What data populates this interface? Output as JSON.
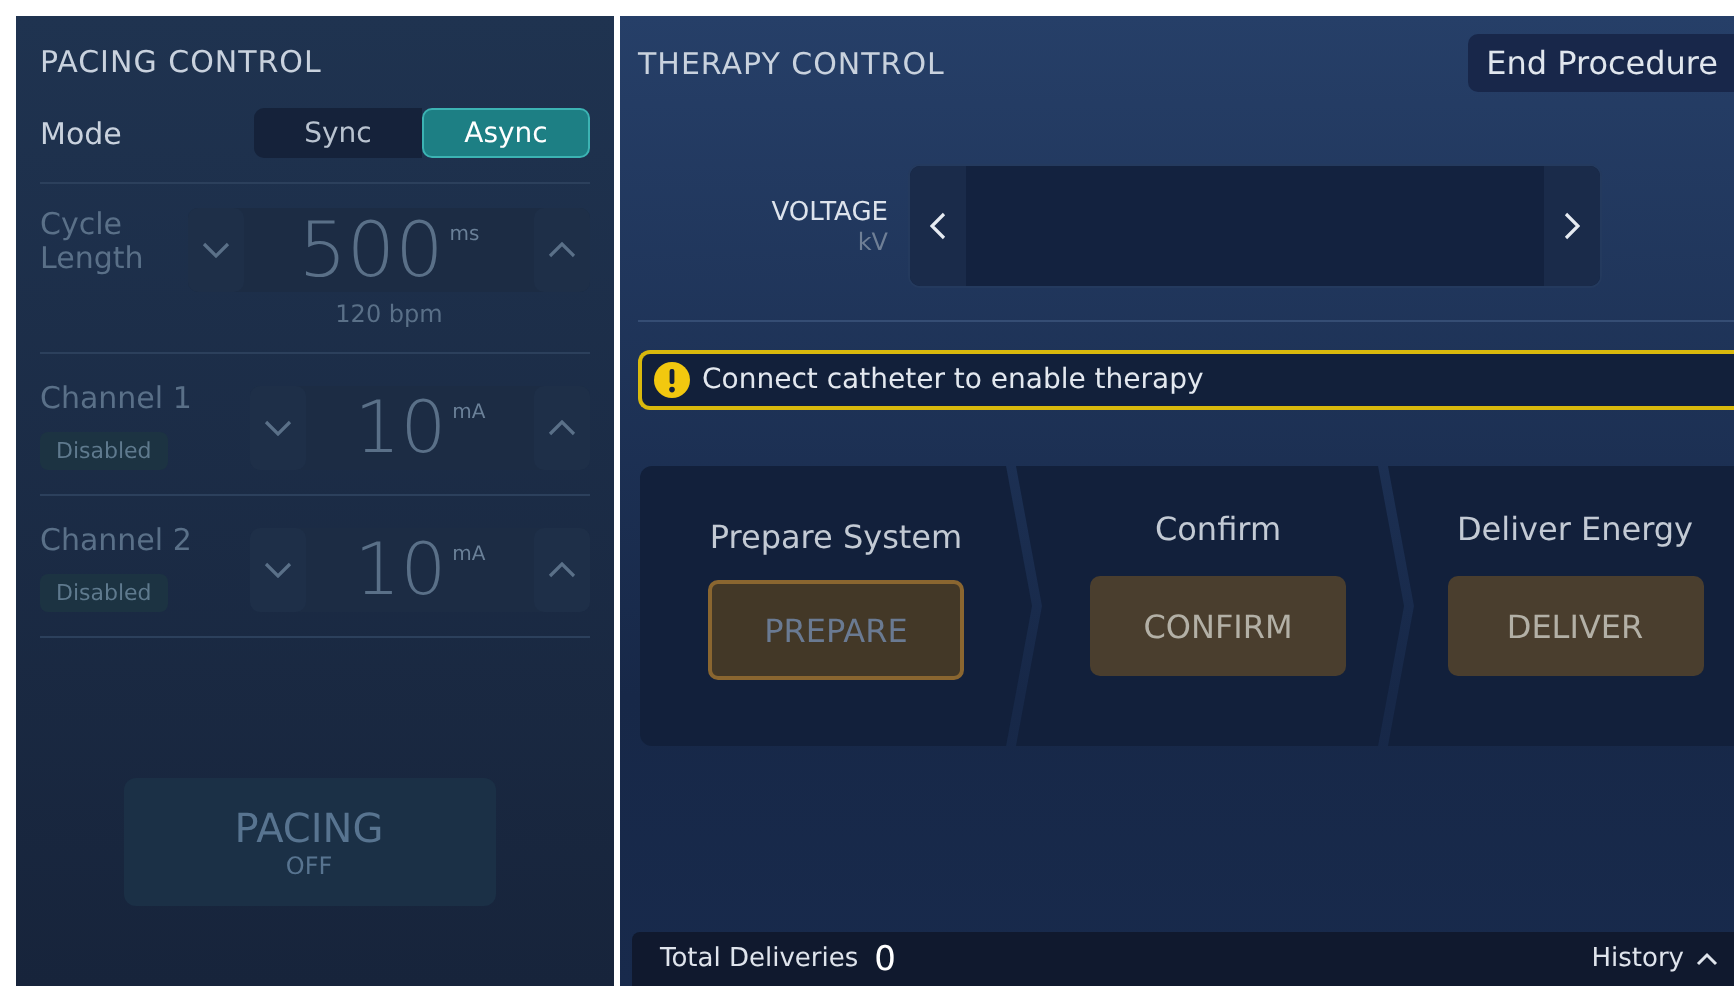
{
  "pacing_control": {
    "title": "PACING CONTROL",
    "mode": {
      "label": "Mode",
      "options": [
        {
          "label": "Sync",
          "selected": false
        },
        {
          "label": "Async",
          "selected": true
        }
      ]
    },
    "cycle_length": {
      "label": "Cycle Length",
      "value": "500",
      "unit": "ms",
      "sub": "120 bpm",
      "disabled": true
    },
    "channels": [
      {
        "name": "Channel 1",
        "badge": "Disabled",
        "value": "10",
        "unit": "mA",
        "disabled": true
      },
      {
        "name": "Channel 2",
        "badge": "Disabled",
        "value": "10",
        "unit": "mA",
        "disabled": true
      }
    ],
    "pacing_button": {
      "label": "PACING",
      "state": "OFF",
      "disabled": true
    }
  },
  "therapy_control": {
    "title": "THERAPY CONTROL",
    "end_button": "End Procedure",
    "voltage": {
      "label": "VOLTAGE",
      "unit": "kV"
    },
    "alert": "Connect catheter to enable therapy",
    "steps": [
      {
        "title": "Prepare System",
        "button": "PREPARE",
        "active": true
      },
      {
        "title": "Confirm",
        "button": "CONFIRM",
        "active": false
      },
      {
        "title": "Deliver Energy",
        "button": "DELIVER",
        "active": false
      }
    ],
    "footer": {
      "label": "Total Deliveries",
      "count": "0",
      "history": "History"
    }
  }
}
